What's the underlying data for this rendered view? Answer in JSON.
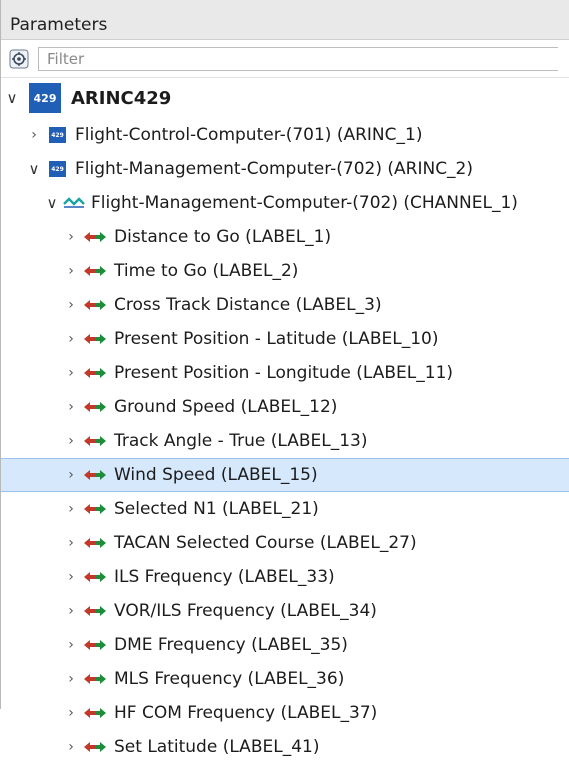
{
  "panel": {
    "title": "Parameters",
    "filter_placeholder": "Filter"
  },
  "tree": {
    "root": {
      "badge": "429",
      "label": "ARINC429"
    },
    "computers": [
      {
        "badge": "429",
        "label": "Flight-Control-Computer-(701) (ARINC_1)",
        "expanded": false
      },
      {
        "badge": "429",
        "label": "Flight-Management-Computer-(702) (ARINC_2)",
        "expanded": true
      }
    ],
    "channel": {
      "label": "Flight-Management-Computer-(702) (CHANNEL_1)"
    },
    "labels": [
      "Distance to Go (LABEL_1)",
      "Time to Go (LABEL_2)",
      "Cross Track Distance (LABEL_3)",
      "Present Position - Latitude (LABEL_10)",
      "Present Position - Longitude (LABEL_11)",
      "Ground Speed (LABEL_12)",
      "Track Angle - True (LABEL_13)",
      "Wind Speed (LABEL_15)",
      "Selected N1 (LABEL_21)",
      "TACAN Selected Course (LABEL_27)",
      "ILS Frequency (LABEL_33)",
      "VOR/ILS Frequency (LABEL_34)",
      "DME Frequency (LABEL_35)",
      "MLS Frequency (LABEL_36)",
      "HF COM Frequency (LABEL_37)",
      "Set Latitude (LABEL_41)"
    ],
    "selected_label": "Wind Speed (LABEL_15)"
  },
  "colors": {
    "badge": "#1f5fb5",
    "selection": "#d6e8fb",
    "arrow_left": "#c0392b",
    "arrow_right": "#1e8c3a"
  },
  "icons": {
    "filter": "filter-settings-icon",
    "collapsed": "chevron-right-icon",
    "expanded": "chevron-down-icon",
    "channel": "channel-icon",
    "label": "bidirectional-arrow-icon"
  }
}
